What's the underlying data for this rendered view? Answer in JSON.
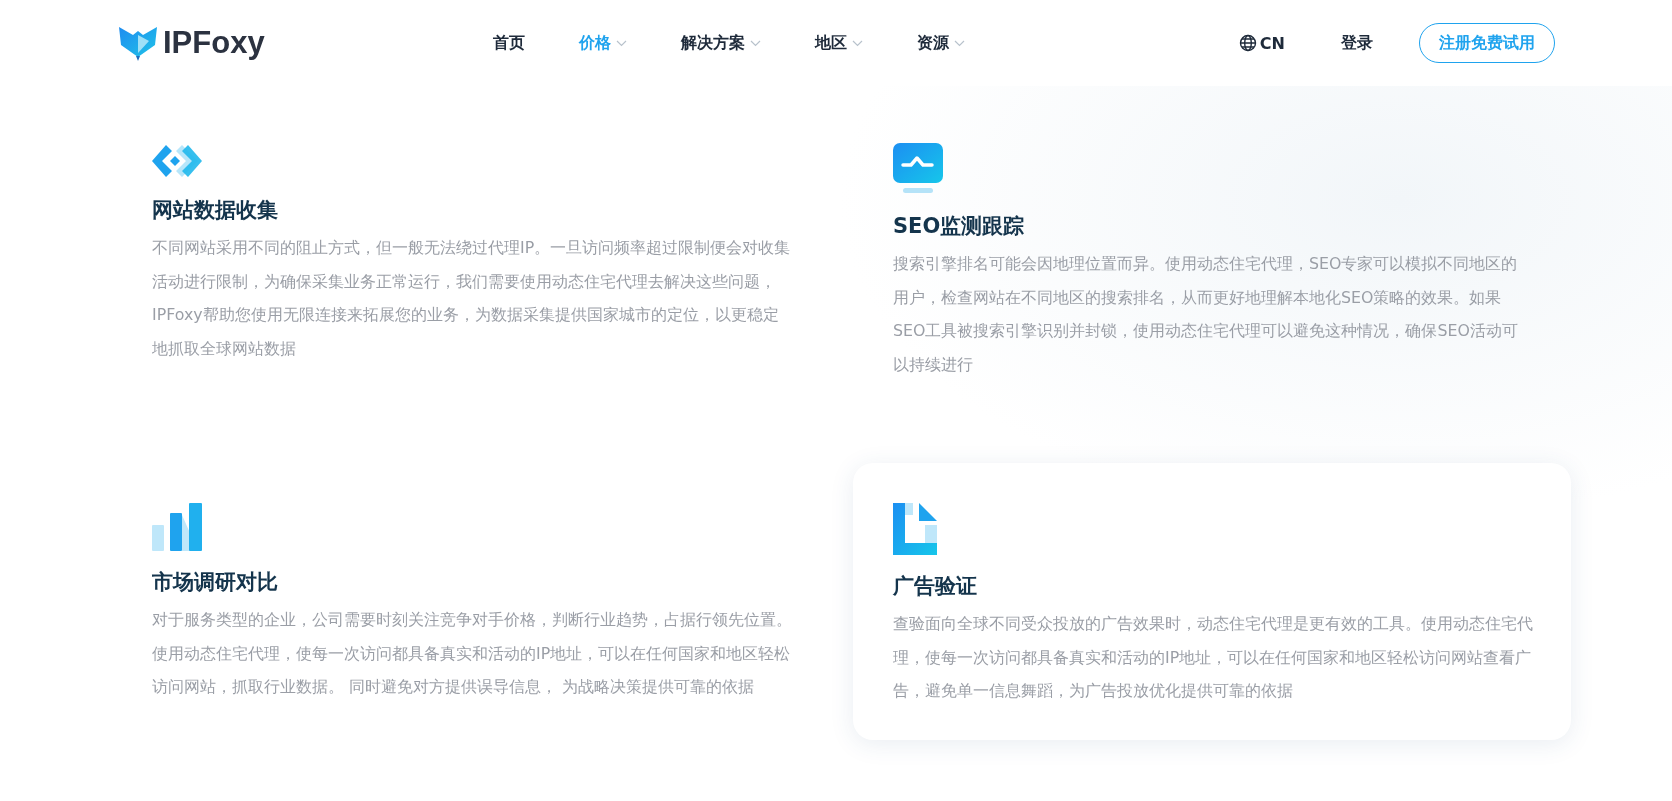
{
  "header": {
    "logo_text": "IPFoxy",
    "nav": [
      {
        "label": "首页",
        "selected": false,
        "dropdown": false
      },
      {
        "label": "价格",
        "selected": true,
        "dropdown": true
      },
      {
        "label": "解决方案",
        "selected": false,
        "dropdown": true
      },
      {
        "label": "地区",
        "selected": false,
        "dropdown": true
      },
      {
        "label": "资源",
        "selected": false,
        "dropdown": true
      }
    ],
    "language": "CN",
    "login": "登录",
    "signup": "注册免费试用"
  },
  "features": [
    {
      "kind": "data",
      "title": "网站数据收集",
      "text": "不同网站采用不同的阻止方式，但一般无法绕过代理IP。一旦访问频率超过限制便会对收集活动进行限制，为确保采集业务正常运行，我们需要使用动态住宅代理去解决这些问题，IPFoxy帮助您使用无限连接来拓展您的业务，为数据采集提供国家城市的定位，以更稳定地抓取全球网站数据",
      "highlighted": false
    },
    {
      "kind": "monitor",
      "title": "SEO监测跟踪",
      "text": "搜索引擎排名可能会因地理位置而异。使用动态住宅代理，SEO专家可以模拟不同地区的用户，检查网站在不同地区的搜索排名，从而更好地理解本地化SEO策略的效果。如果SEO工具被搜索引擎识别并封锁，使用动态住宅代理可以避免这种情况，确保SEO活动可以持续进行",
      "highlighted": false
    },
    {
      "kind": "chart",
      "title": "市场调研对比",
      "text": "对于服务类型的企业，公司需要时刻关注竞争对手价格，判断行业趋势，占据行领先位置。使用动态住宅代理，使每一次访问都具备真实和活动的IP地址，可以在任何国家和地区轻松访问网站，抓取行业数据。 同时避免对方提供误导信息， 为战略决策提供可靠的依据",
      "highlighted": false
    },
    {
      "kind": "document",
      "title": "广告验证",
      "text": "查验面向全球不同受众投放的广告效果时，动态住宅代理是更有效的工具。使用动态住宅代理，使每一次访问都具备真实和活动的IP地址，可以在任何国家和地区轻松访问网站查看广告，避免单一信息舞蹈，为广告投放优化提供可靠的依据",
      "highlighted": true
    }
  ]
}
